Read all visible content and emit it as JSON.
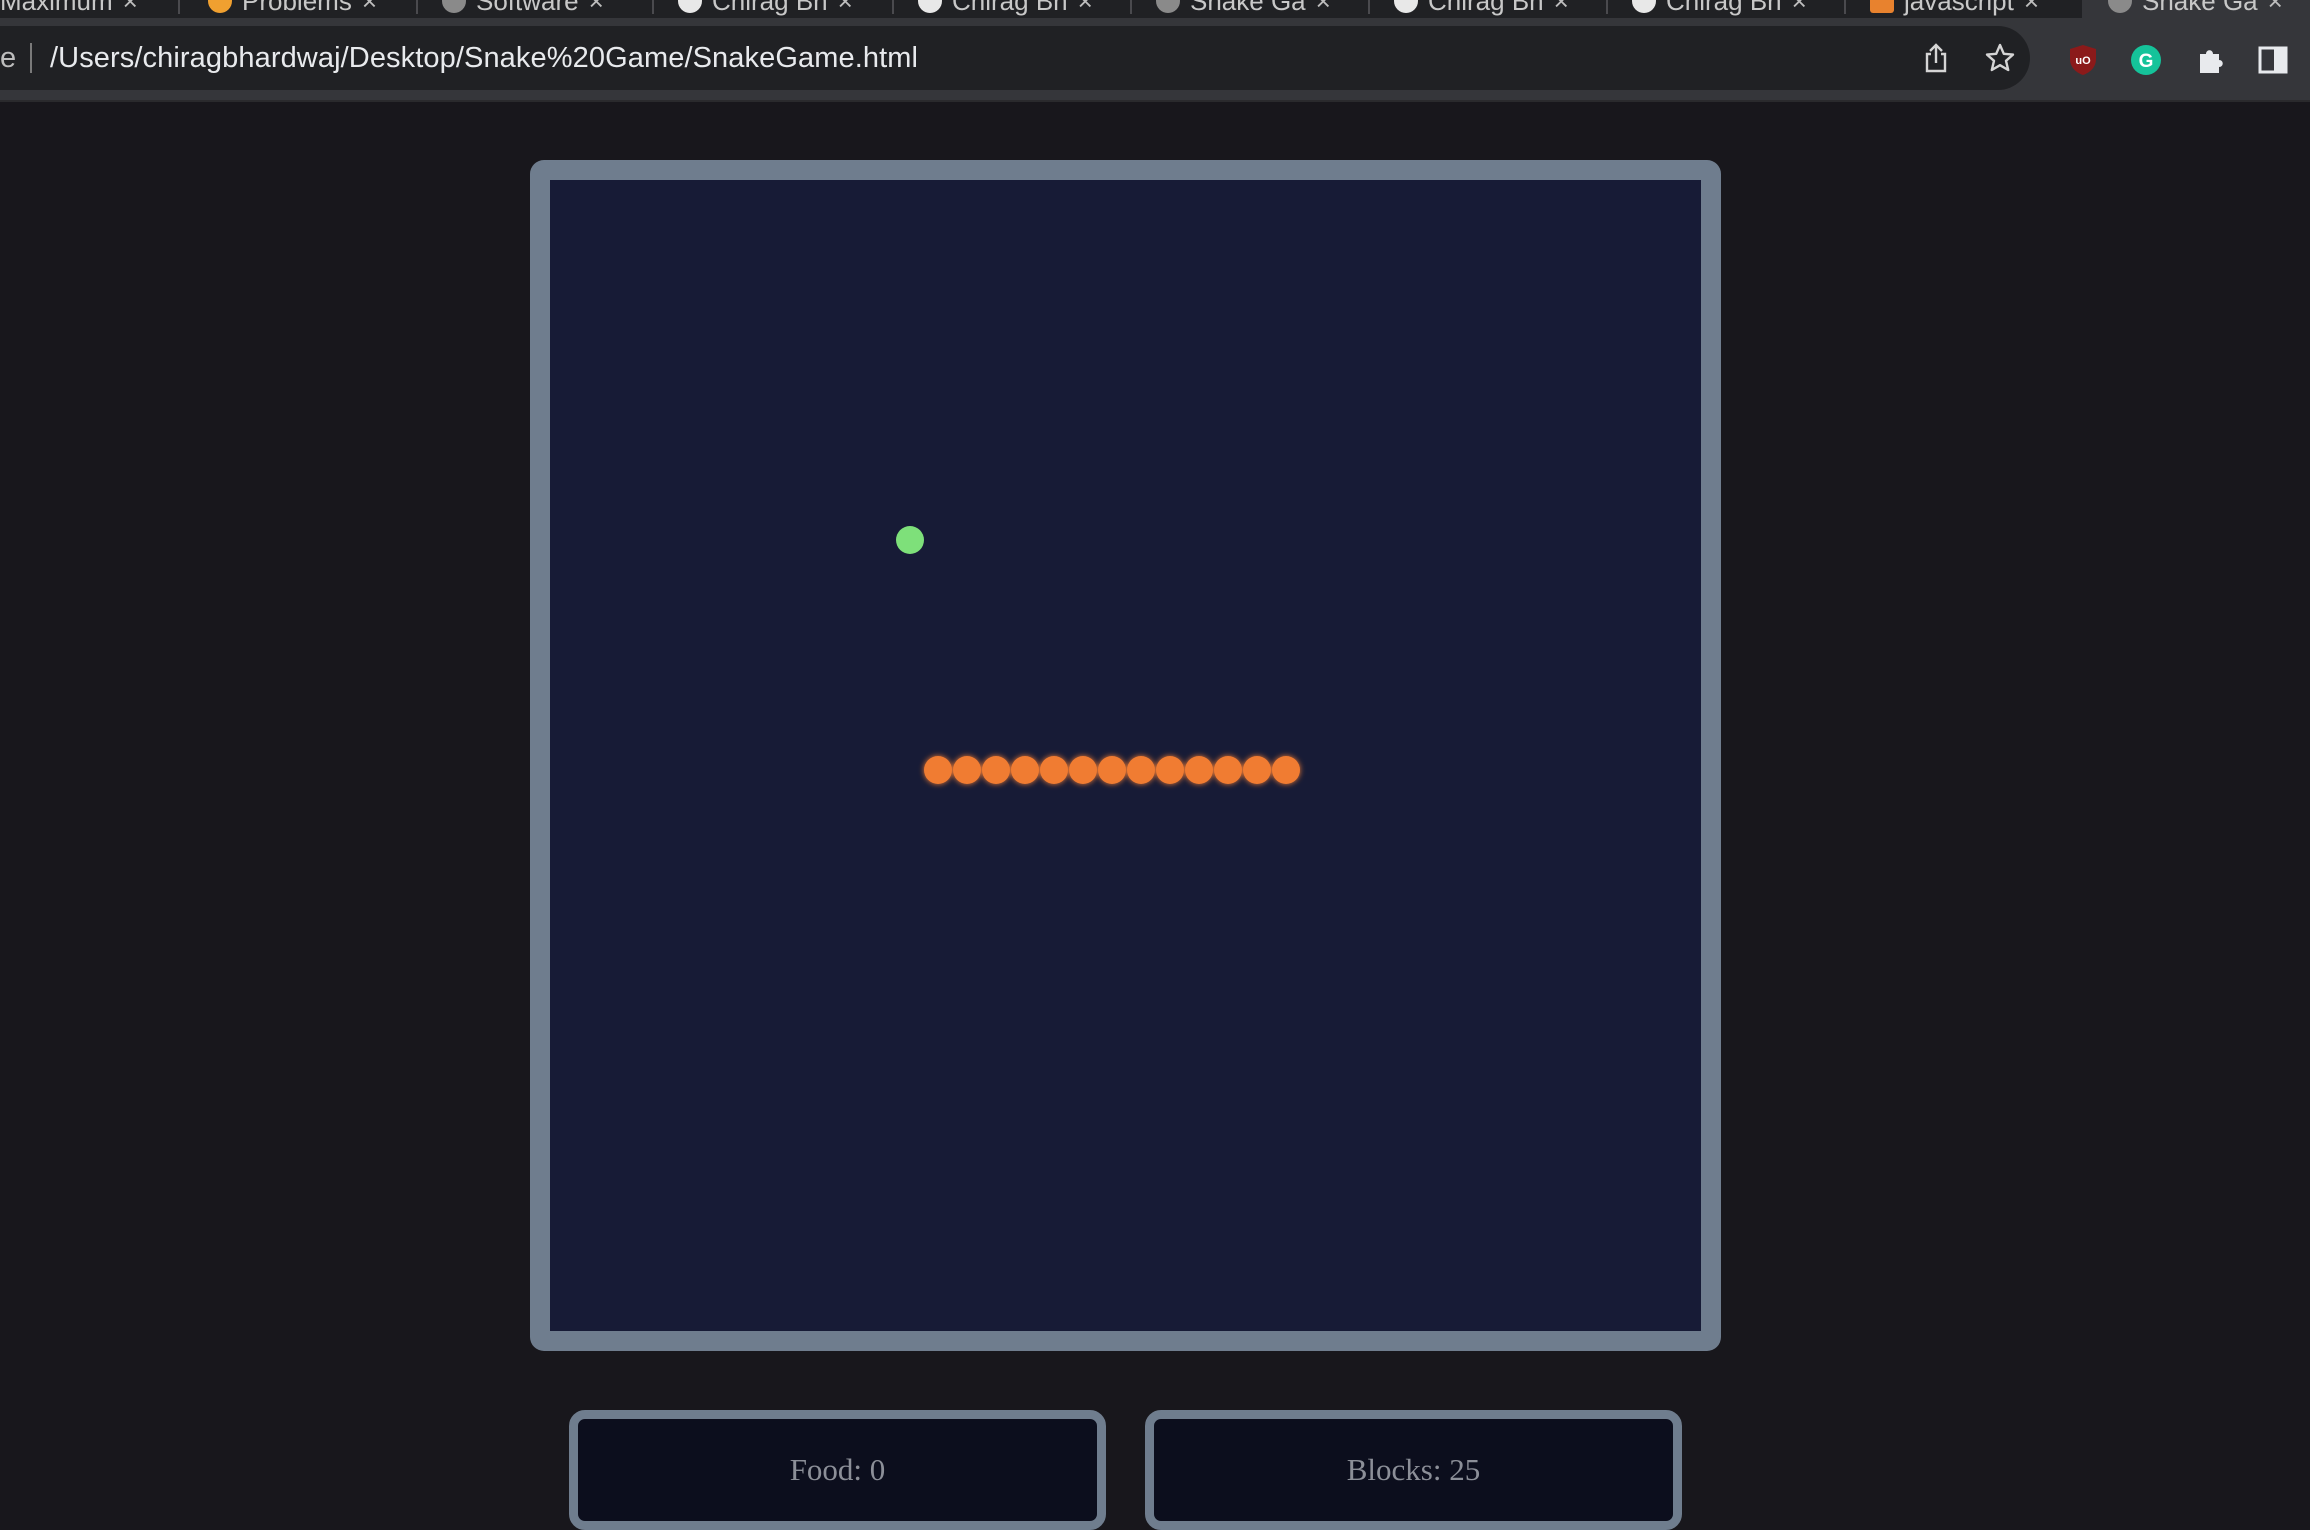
{
  "browser": {
    "tabs": [
      {
        "title": "Maximum",
        "icon": "page-icon"
      },
      {
        "title": "Problems",
        "icon": "leetcode-icon"
      },
      {
        "title": "Software",
        "icon": "apple-icon"
      },
      {
        "title": "Chirag Bh",
        "icon": "github-icon"
      },
      {
        "title": "Chirag Bh",
        "icon": "threads-icon"
      },
      {
        "title": "Snake Ga",
        "icon": "globe-icon"
      },
      {
        "title": "Chirag Bh",
        "icon": "github-icon"
      },
      {
        "title": "Chirag Bh",
        "icon": "threads-icon"
      },
      {
        "title": "javascript",
        "icon": "stackoverflow-icon"
      },
      {
        "title": "Snake Ga",
        "icon": "globe-icon"
      }
    ],
    "omnibox": {
      "prefix": "e",
      "url": "/Users/chiragbhardwaj/Desktop/Snake%20Game/SnakeGame.html"
    },
    "colors": {
      "ublock": "#8b1a1a",
      "grammarly": "#15c39a"
    }
  },
  "game": {
    "colors": {
      "board": "#171b36",
      "frame": "#6f7d8e",
      "snake": "#f07b30",
      "food": "#7ee07a"
    },
    "food": "Food: 0",
    "blocks": "Blocks: 25"
  }
}
